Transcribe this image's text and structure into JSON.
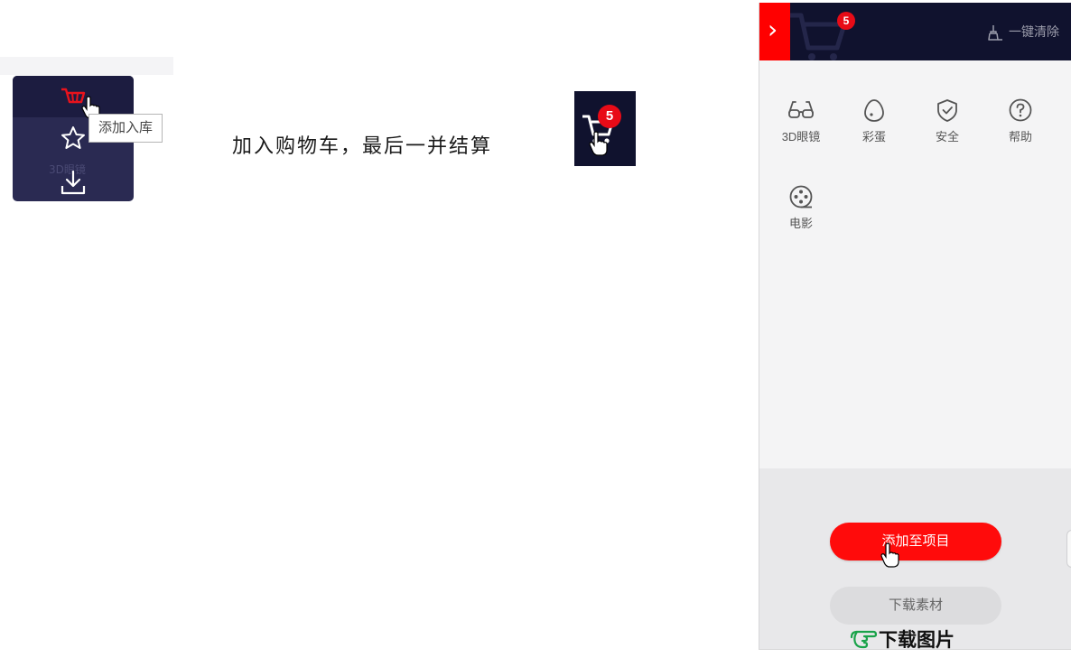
{
  "left_toolbar": {
    "tooltip": "添加入库",
    "ghost_label": "3D眼镜",
    "icons": [
      "cart-icon",
      "star-icon",
      "download-icon",
      "pointer-hand-icon"
    ]
  },
  "caption": "加入购物车，最后一并结算",
  "middle_cart": {
    "badge": "5",
    "icons": [
      "cart-icon",
      "pointer-hand-icon"
    ]
  },
  "panel": {
    "badge": "5",
    "clear_label": "一键清除",
    "collapse_glyph": "›",
    "categories": [
      {
        "label": "3D眼镜",
        "icon": "glasses-icon"
      },
      {
        "label": "彩蛋",
        "icon": "egg-icon"
      },
      {
        "label": "安全",
        "icon": "shield-check-icon"
      },
      {
        "label": "帮助",
        "icon": "help-icon"
      },
      {
        "label": "电影",
        "icon": "film-reel-icon"
      }
    ],
    "add_button": "添加至项目",
    "download_button": "下载素材",
    "watermark": "下载图片"
  },
  "colors": {
    "dark_navy": "#10122e",
    "accent_red": "#ff0b0b",
    "badge_red": "#e80b17",
    "panel_bg": "#f4f4f5"
  }
}
